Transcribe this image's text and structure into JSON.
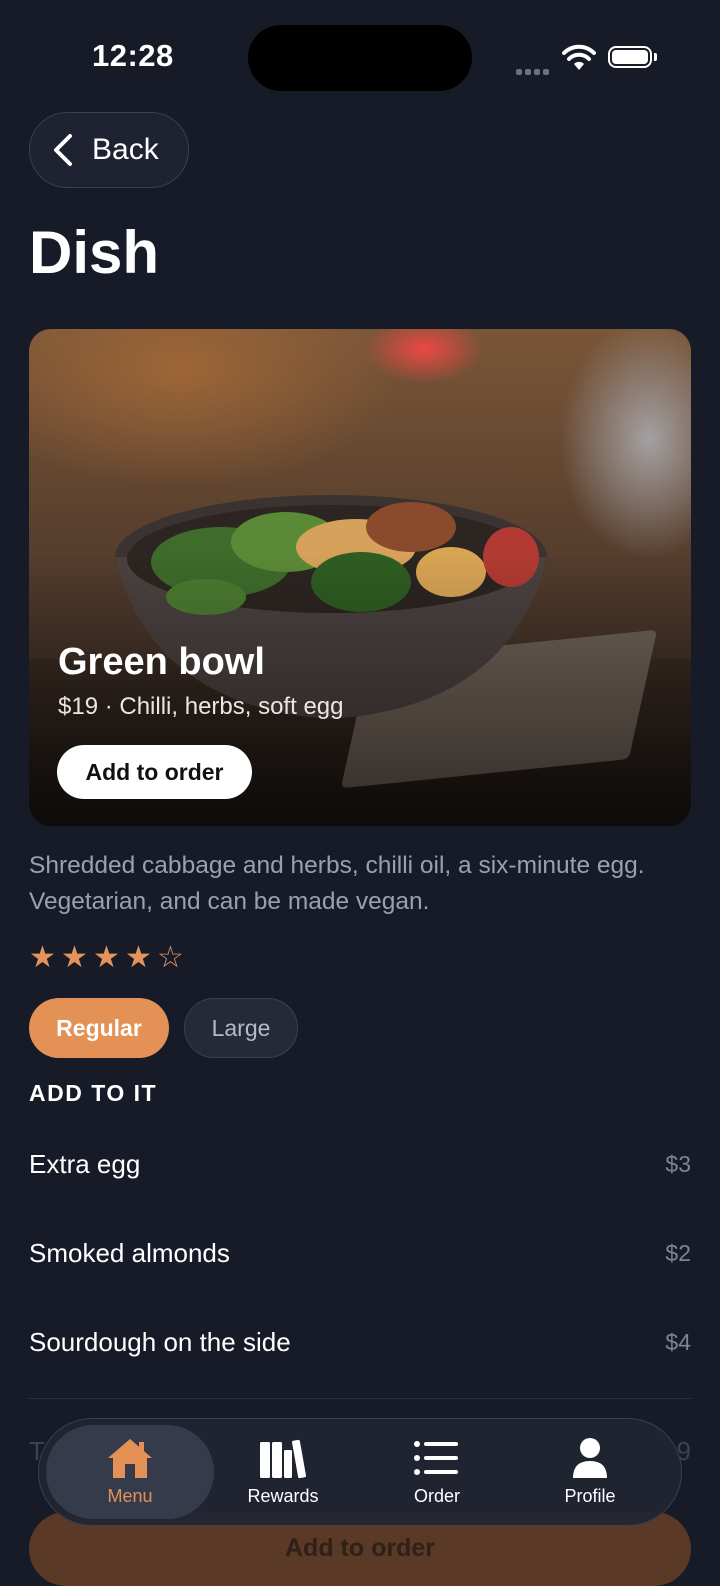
{
  "status_bar": {
    "time": "12:28"
  },
  "nav": {
    "back_label": "Back"
  },
  "page": {
    "title": "Dish"
  },
  "hero": {
    "name": "Green bowl",
    "subtitle": "$19 · Chilli, herbs, soft egg",
    "add_label": "Add to order"
  },
  "description": "Shredded cabbage and herbs, chilli oil, a six-minute egg. Vegetarian, and can be made vegan.",
  "rating": {
    "value": 4,
    "max": 5,
    "stars": [
      "★",
      "★",
      "★",
      "★",
      "☆"
    ]
  },
  "sizes": {
    "regular": "Regular",
    "large": "Large",
    "selected": "Regular"
  },
  "addons": {
    "title": "ADD TO IT",
    "items": [
      {
        "name": "Extra egg",
        "price": "$3"
      },
      {
        "name": "Smoked almonds",
        "price": "$2"
      },
      {
        "name": "Sourdough on the side",
        "price": "$4"
      }
    ]
  },
  "total": {
    "label": "T",
    "value": "9"
  },
  "cta": {
    "label": "Add to order"
  },
  "tabs": [
    {
      "label": "Menu",
      "icon": "house-icon",
      "active": true
    },
    {
      "label": "Rewards",
      "icon": "books-icon"
    },
    {
      "label": "Order",
      "icon": "list-icon"
    },
    {
      "label": "Profile",
      "icon": "person-icon"
    }
  ],
  "colors": {
    "accent": "#e39155",
    "background": "#171b28",
    "star": "#e3945b"
  }
}
